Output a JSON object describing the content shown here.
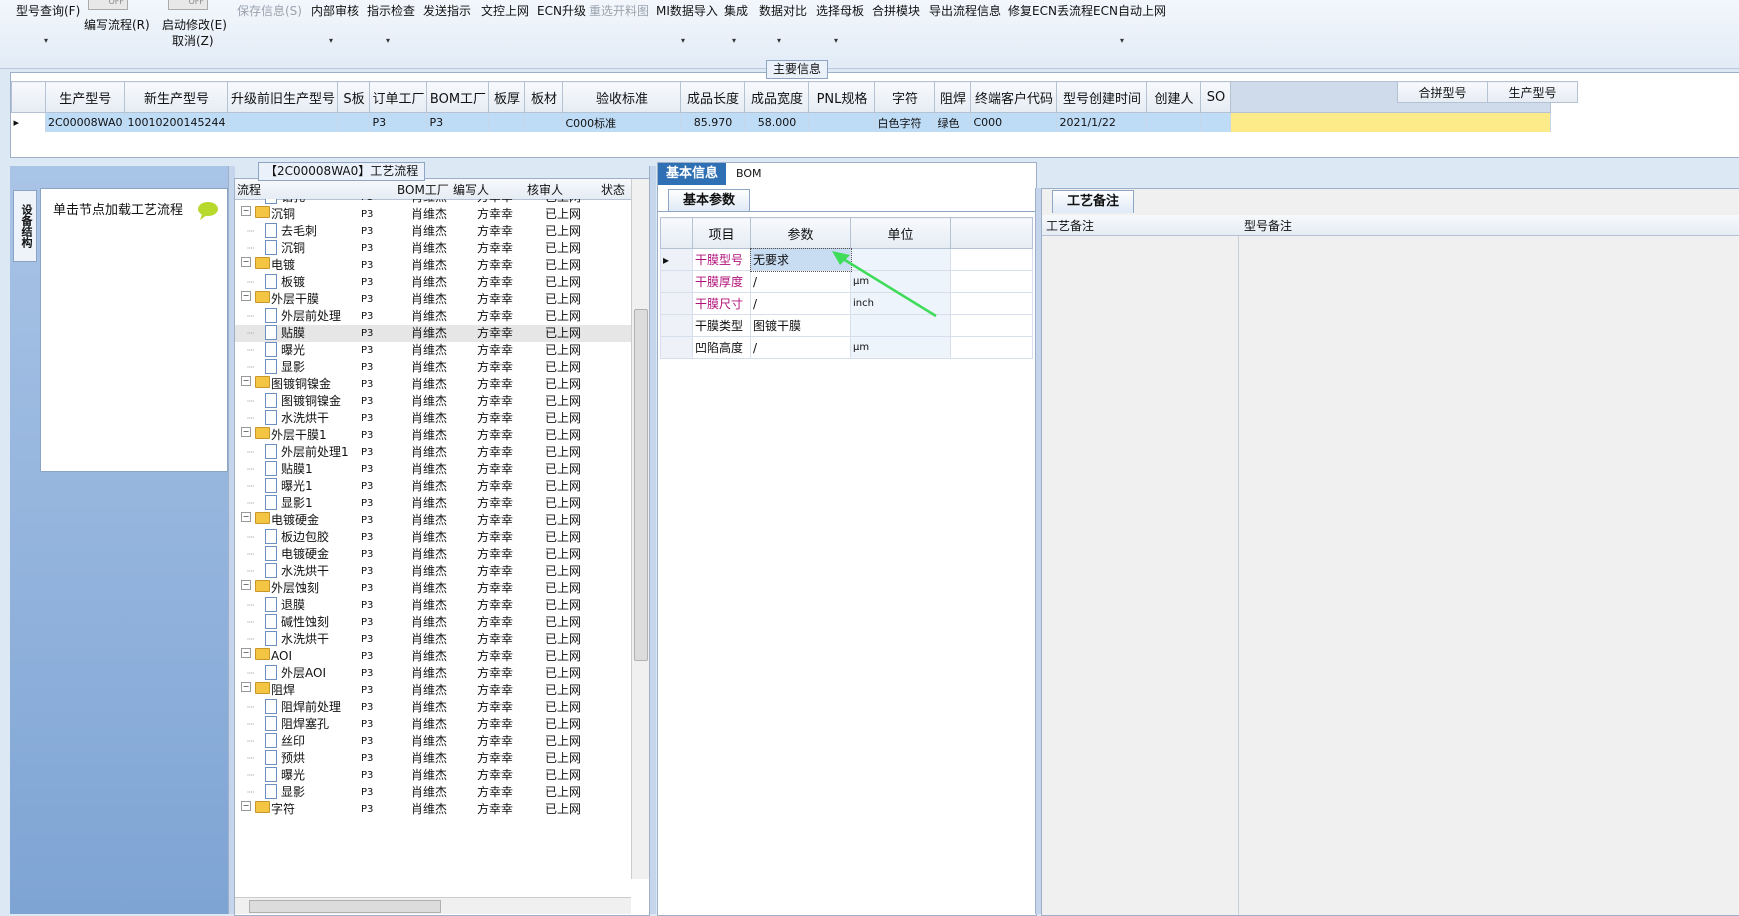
{
  "toolbar": {
    "items": [
      {
        "label": "型号查询(F)",
        "disabled": false
      },
      {
        "label": "保存信息(S)",
        "disabled": true
      },
      {
        "label": "内部审核",
        "disabled": false
      },
      {
        "label": "指示检查",
        "disabled": false
      },
      {
        "label": "发送指示",
        "disabled": false
      },
      {
        "label": "文控上网",
        "disabled": false
      },
      {
        "label": "ECN升级",
        "disabled": false
      },
      {
        "label": "重选开料图",
        "disabled": true
      },
      {
        "label": "MI数据导入",
        "disabled": false
      },
      {
        "label": "集成",
        "disabled": false
      },
      {
        "label": "数据对比",
        "disabled": false
      },
      {
        "label": "选择母板",
        "disabled": false
      },
      {
        "label": "合拼模块",
        "disabled": false
      },
      {
        "label": "导出流程信息",
        "disabled": false
      },
      {
        "label": "修复ECN丢流程",
        "disabled": false
      },
      {
        "label": "ECN自动上网",
        "disabled": false
      }
    ],
    "write_flow": "编写流程(R)",
    "start_modify": "启动修改(E)",
    "cancel": "取消(Z)",
    "toggle_off": "OFF",
    "drop": "▾"
  },
  "main_info": {
    "title": "主要信息",
    "columns": [
      "生产型号",
      "新生产型号",
      "升级前旧生产型号",
      "S板",
      "订单工厂",
      "BOM工厂",
      "板厚",
      "板材",
      "验收标准",
      "成品长度",
      "成品宽度",
      "PNL规格",
      "字符",
      "阻焊",
      "终端客户代码",
      "型号创建时间",
      "创建人",
      "SO"
    ],
    "row": [
      "2C00008WA0",
      "10010200145244",
      "",
      "",
      "P3",
      "P3",
      "",
      "",
      "C000标准",
      "85.970",
      "58.000",
      "",
      "白色字符",
      "绿色",
      "C000",
      "2021/1/22",
      "",
      ""
    ],
    "right_columns": [
      "合拼型号",
      "生产型号"
    ]
  },
  "left_panel": {
    "vtab": "设备结构",
    "hint": "单击节点加载工艺流程"
  },
  "tree": {
    "title": "【2C00008WA0】工艺流程",
    "columns": [
      "流程",
      "BOM工厂",
      "编写人",
      "核审人",
      "状态"
    ],
    "rows": [
      {
        "name": "钻孔",
        "type": "doc",
        "level": 2,
        "bom": "P3",
        "writer": "肖维杰",
        "reviewer": "方幸幸",
        "status": "已上网"
      },
      {
        "name": "沉铜",
        "type": "folder",
        "level": 1,
        "bom": "P3",
        "writer": "肖维杰",
        "reviewer": "方幸幸",
        "status": "已上网"
      },
      {
        "name": "去毛刺",
        "type": "doc",
        "level": 2,
        "bom": "P3",
        "writer": "肖维杰",
        "reviewer": "方幸幸",
        "status": "已上网"
      },
      {
        "name": "沉铜",
        "type": "doc",
        "level": 2,
        "bom": "P3",
        "writer": "肖维杰",
        "reviewer": "方幸幸",
        "status": "已上网"
      },
      {
        "name": "电镀",
        "type": "folder",
        "level": 1,
        "bom": "P3",
        "writer": "肖维杰",
        "reviewer": "方幸幸",
        "status": "已上网"
      },
      {
        "name": "板镀",
        "type": "doc",
        "level": 2,
        "bom": "P3",
        "writer": "肖维杰",
        "reviewer": "方幸幸",
        "status": "已上网"
      },
      {
        "name": "外层干膜",
        "type": "folder",
        "level": 1,
        "bom": "P3",
        "writer": "肖维杰",
        "reviewer": "方幸幸",
        "status": "已上网"
      },
      {
        "name": "外层前处理",
        "type": "doc",
        "level": 2,
        "bom": "P3",
        "writer": "肖维杰",
        "reviewer": "方幸幸",
        "status": "已上网"
      },
      {
        "name": "贴膜",
        "type": "doc",
        "level": 2,
        "bom": "P3",
        "writer": "肖维杰",
        "reviewer": "方幸幸",
        "status": "已上网",
        "selected": true
      },
      {
        "name": "曝光",
        "type": "doc",
        "level": 2,
        "bom": "P3",
        "writer": "肖维杰",
        "reviewer": "方幸幸",
        "status": "已上网"
      },
      {
        "name": "显影",
        "type": "doc",
        "level": 2,
        "bom": "P3",
        "writer": "肖维杰",
        "reviewer": "方幸幸",
        "status": "已上网"
      },
      {
        "name": "图镀铜镍金",
        "type": "folder",
        "level": 1,
        "bom": "P3",
        "writer": "肖维杰",
        "reviewer": "方幸幸",
        "status": "已上网"
      },
      {
        "name": "图镀铜镍金",
        "type": "doc",
        "level": 2,
        "bom": "P3",
        "writer": "肖维杰",
        "reviewer": "方幸幸",
        "status": "已上网"
      },
      {
        "name": "水洗烘干",
        "type": "doc",
        "level": 2,
        "bom": "P3",
        "writer": "肖维杰",
        "reviewer": "方幸幸",
        "status": "已上网"
      },
      {
        "name": "外层干膜1",
        "type": "folder",
        "level": 1,
        "bom": "P3",
        "writer": "肖维杰",
        "reviewer": "方幸幸",
        "status": "已上网"
      },
      {
        "name": "外层前处理1",
        "type": "doc",
        "level": 2,
        "bom": "P3",
        "writer": "肖维杰",
        "reviewer": "方幸幸",
        "status": "已上网"
      },
      {
        "name": "贴膜1",
        "type": "doc",
        "level": 2,
        "bom": "P3",
        "writer": "肖维杰",
        "reviewer": "方幸幸",
        "status": "已上网"
      },
      {
        "name": "曝光1",
        "type": "doc",
        "level": 2,
        "bom": "P3",
        "writer": "肖维杰",
        "reviewer": "方幸幸",
        "status": "已上网"
      },
      {
        "name": "显影1",
        "type": "doc",
        "level": 2,
        "bom": "P3",
        "writer": "肖维杰",
        "reviewer": "方幸幸",
        "status": "已上网"
      },
      {
        "name": "电镀硬金",
        "type": "folder",
        "level": 1,
        "bom": "P3",
        "writer": "肖维杰",
        "reviewer": "方幸幸",
        "status": "已上网"
      },
      {
        "name": "板边包胶",
        "type": "doc",
        "level": 2,
        "bom": "P3",
        "writer": "肖维杰",
        "reviewer": "方幸幸",
        "status": "已上网"
      },
      {
        "name": "电镀硬金",
        "type": "doc",
        "level": 2,
        "bom": "P3",
        "writer": "肖维杰",
        "reviewer": "方幸幸",
        "status": "已上网"
      },
      {
        "name": "水洗烘干",
        "type": "doc",
        "level": 2,
        "bom": "P3",
        "writer": "肖维杰",
        "reviewer": "方幸幸",
        "status": "已上网"
      },
      {
        "name": "外层蚀刻",
        "type": "folder",
        "level": 1,
        "bom": "P3",
        "writer": "肖维杰",
        "reviewer": "方幸幸",
        "status": "已上网"
      },
      {
        "name": "退膜",
        "type": "doc",
        "level": 2,
        "bom": "P3",
        "writer": "肖维杰",
        "reviewer": "方幸幸",
        "status": "已上网"
      },
      {
        "name": "碱性蚀刻",
        "type": "doc",
        "level": 2,
        "bom": "P3",
        "writer": "肖维杰",
        "reviewer": "方幸幸",
        "status": "已上网"
      },
      {
        "name": "水洗烘干",
        "type": "doc",
        "level": 2,
        "bom": "P3",
        "writer": "肖维杰",
        "reviewer": "方幸幸",
        "status": "已上网"
      },
      {
        "name": "AOI",
        "type": "folder",
        "level": 1,
        "bom": "P3",
        "writer": "肖维杰",
        "reviewer": "方幸幸",
        "status": "已上网"
      },
      {
        "name": "外层AOI",
        "type": "doc",
        "level": 2,
        "bom": "P3",
        "writer": "肖维杰",
        "reviewer": "方幸幸",
        "status": "已上网"
      },
      {
        "name": "阻焊",
        "type": "folder",
        "level": 1,
        "bom": "P3",
        "writer": "肖维杰",
        "reviewer": "方幸幸",
        "status": "已上网"
      },
      {
        "name": "阻焊前处理",
        "type": "doc",
        "level": 2,
        "bom": "P3",
        "writer": "肖维杰",
        "reviewer": "方幸幸",
        "status": "已上网"
      },
      {
        "name": "阻焊塞孔",
        "type": "doc",
        "level": 2,
        "bom": "P3",
        "writer": "肖维杰",
        "reviewer": "方幸幸",
        "status": "已上网"
      },
      {
        "name": "丝印",
        "type": "doc",
        "level": 2,
        "bom": "P3",
        "writer": "肖维杰",
        "reviewer": "方幸幸",
        "status": "已上网"
      },
      {
        "name": "预烘",
        "type": "doc",
        "level": 2,
        "bom": "P3",
        "writer": "肖维杰",
        "reviewer": "方幸幸",
        "status": "已上网"
      },
      {
        "name": "曝光",
        "type": "doc",
        "level": 2,
        "bom": "P3",
        "writer": "肖维杰",
        "reviewer": "方幸幸",
        "status": "已上网"
      },
      {
        "name": "显影",
        "type": "doc",
        "level": 2,
        "bom": "P3",
        "writer": "肖维杰",
        "reviewer": "方幸幸",
        "status": "已上网"
      },
      {
        "name": "字符",
        "type": "folder",
        "level": 1,
        "bom": "P3",
        "writer": "肖维杰",
        "reviewer": "方幸幸",
        "status": "已上网"
      }
    ]
  },
  "center": {
    "tabs": [
      "基本信息",
      "BOM"
    ],
    "subtab": "基本参数",
    "columns": [
      "项目",
      "参数",
      "单位"
    ],
    "rows": [
      {
        "item": "干膜型号",
        "value": "无要求",
        "unit": "",
        "highlight": true
      },
      {
        "item": "干膜厚度",
        "value": "/",
        "unit": "μm",
        "highlight": true
      },
      {
        "item": "干膜尺寸",
        "value": "/",
        "unit": "inch",
        "highlight": true
      },
      {
        "item": "干膜类型",
        "value": "图镀干膜",
        "unit": "",
        "highlight": false
      },
      {
        "item": "凹陷高度",
        "value": "/",
        "unit": "μm",
        "highlight": false
      }
    ]
  },
  "right": {
    "subtab": "工艺备注",
    "columns": [
      "工艺备注",
      "型号备注"
    ]
  },
  "colors": {
    "highlight_label": "#b0127a",
    "accent": "#2f6fb3",
    "arrow": "#3fdc5a"
  }
}
